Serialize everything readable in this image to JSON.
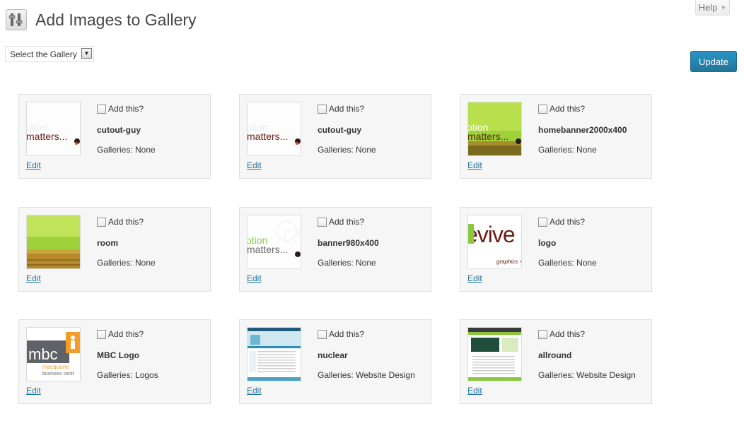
{
  "header": {
    "title": "Add Images to Gallery",
    "help_label": "Help"
  },
  "toolbar": {
    "gallery_select_value": "Select the Gallery",
    "update_label": "Update"
  },
  "common": {
    "add_label": "Add this?",
    "edit_label": "Edit"
  },
  "images": [
    {
      "name": "cutout-guy",
      "galleries": "Galleries: None",
      "thumb": "option-matters"
    },
    {
      "name": "cutout-guy",
      "galleries": "Galleries: None",
      "thumb": "option-matters"
    },
    {
      "name": "homebanner2000x400",
      "galleries": "Galleries: None",
      "thumb": "green-banner"
    },
    {
      "name": "room",
      "galleries": "Galleries: None",
      "thumb": "green-room"
    },
    {
      "name": "banner980x400",
      "galleries": "Galleries: None",
      "thumb": "option-matters-green"
    },
    {
      "name": "logo",
      "galleries": "Galleries: None",
      "thumb": "evive-logo"
    },
    {
      "name": "MBC Logo",
      "galleries": "Galleries: Logos",
      "thumb": "mbc-logo"
    },
    {
      "name": "nuclear",
      "galleries": "Galleries: Website Design",
      "thumb": "website-blue"
    },
    {
      "name": "allround",
      "galleries": "Galleries: Website Design",
      "thumb": "website-green"
    }
  ],
  "thumb_text": {
    "option": "otion",
    "matters": "matters...",
    "evive": "evive",
    "evive_sub": "graphics + w",
    "mbc": "mbc",
    "macquarie": "macquarie",
    "business": "business centr"
  },
  "colors": {
    "link": "#21759b",
    "button": "#21759b",
    "card_bg": "#f6f6f6",
    "green": "#8cc63f"
  }
}
